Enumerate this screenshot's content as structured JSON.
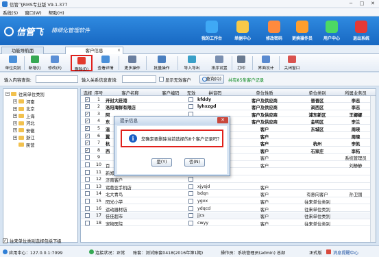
{
  "window": {
    "title": "信管飞RMS专业版 V9.1.377",
    "min": "─",
    "max": "□",
    "close": "✕"
  },
  "menu": [
    "系统(S)",
    "窗口(W)",
    "帮助(H)"
  ],
  "banner": {
    "logo": "信管飞",
    "subtitle": "精细化管理软件",
    "nav": [
      {
        "label": "我的工作台",
        "color": "#3fa9f5"
      },
      {
        "label": "单据中心",
        "color": "#f7c948"
      },
      {
        "label": "修改密码",
        "color": "#ff8a3d"
      },
      {
        "label": "更换操作员",
        "color": "#ff9e2c"
      },
      {
        "label": "用户中心",
        "color": "#4cd964"
      },
      {
        "label": "退出系统",
        "color": "#e53935"
      }
    ]
  },
  "tabs": [
    {
      "label": "功能导航面"
    },
    {
      "label": "客户信息",
      "close": "×"
    }
  ],
  "toolbar": [
    {
      "label": "单位类别",
      "icon": "category-icon",
      "color": "#4a90d9"
    },
    {
      "label": "新增(I)",
      "icon": "add-icon",
      "color": "#35a853"
    },
    {
      "label": "修改(E)",
      "icon": "edit-icon",
      "color": "#5b8fd6"
    },
    {
      "label": "删除(D)",
      "icon": "delete-icon",
      "color": "#e23a2e"
    },
    {
      "label": "查看详情",
      "icon": "view-icon",
      "color": "#4a90d9"
    },
    {
      "label": "更多操作",
      "icon": "more-icon",
      "color": "#6a7fa0"
    },
    {
      "label": "批量操作",
      "icon": "batch-icon",
      "color": "#4a7fc0"
    },
    {
      "label": "导入导出",
      "icon": "import-export-icon",
      "color": "#3aa0c8"
    },
    {
      "label": "排序设置",
      "icon": "sort-icon",
      "color": "#7a8fb0"
    },
    {
      "label": "打印",
      "icon": "print-icon",
      "color": "#6a7a90"
    },
    {
      "label": "界面设计",
      "icon": "layout-icon",
      "color": "#5a8ad0"
    },
    {
      "label": "关闭窗口",
      "icon": "close-window-icon",
      "color": "#d9534f"
    }
  ],
  "search": {
    "query_label": "输入内容查询:",
    "query_value": "",
    "condition_label": "输入关系信息查询:",
    "condition_value": "",
    "show_invalid": "显示无效客户",
    "query_button": "查询(Q)",
    "result": "共有85条客户记录"
  },
  "tree": {
    "root": "往来单位类别",
    "items": [
      "河南",
      "北京",
      "上海",
      "河北",
      "安徽",
      "浙江",
      "民营"
    ],
    "footer": "往来单位类别选择包括下级"
  },
  "table": {
    "columns": [
      "选择",
      "序号",
      "客户名称",
      "客户编码",
      "无效",
      "拼音码",
      "单位性质",
      "单位类别",
      "所属业务员"
    ],
    "rows": [
      {
        "sel": "✓",
        "no": "1",
        "name": "开封大莊港",
        "code": "",
        "inv": "",
        "py": "kfddy",
        "nature": "客户及供应商",
        "category": "晋晋区",
        "salesman": "李志",
        "bold": true
      },
      {
        "sel": "✓",
        "no": "2",
        "name": "洛阳海鲜有限店",
        "code": "",
        "inv": "",
        "py": "lyhxzgd",
        "nature": "客户及供应商",
        "category": "涧西区",
        "salesman": "李志",
        "bold": true
      },
      {
        "sel": "✓",
        "no": "3",
        "name": "阿",
        "code": "",
        "inv": "",
        "py": "",
        "nature": "客户及供应商",
        "category": "浦东新区",
        "salesman": "王娜娜",
        "bold": true
      },
      {
        "sel": "✓",
        "no": "4",
        "name": "东",
        "code": "",
        "inv": "",
        "py": "",
        "nature": "客户及供应商",
        "category": "金明区",
        "salesman": "李兰",
        "bold": true
      },
      {
        "sel": "✓",
        "no": "5",
        "name": "温",
        "code": "",
        "inv": "",
        "py": "",
        "nature": "客户",
        "category": "东城区",
        "salesman": "周晓",
        "bold": true
      },
      {
        "sel": "✓",
        "no": "6",
        "name": "翼",
        "code": "",
        "inv": "",
        "py": "",
        "nature": "客户",
        "category": "",
        "salesman": "周晓",
        "bold": true
      },
      {
        "sel": "✓",
        "no": "7",
        "name": "杭",
        "code": "",
        "inv": "",
        "py": "",
        "nature": "客户",
        "category": "杭州",
        "salesman": "李凯",
        "bold": true
      },
      {
        "sel": "✓",
        "no": "8",
        "name": "西",
        "code": "",
        "inv": "",
        "py": "",
        "nature": "客户",
        "category": "石家庄",
        "salesman": "李拓",
        "bold": true
      },
      {
        "sel": "",
        "no": "9",
        "name": "",
        "code": "",
        "inv": "",
        "py": "",
        "nature": "客户",
        "category": "",
        "salesman": "系统管理员",
        "bold": false
      },
      {
        "sel": "",
        "no": "10",
        "name": "百",
        "code": "",
        "inv": "",
        "py": "",
        "nature": "客户",
        "category": "",
        "salesman": "刘静静",
        "bold": false
      },
      {
        "sel": "",
        "no": "11",
        "name": "新郑市民",
        "code": "",
        "inv": "",
        "py": "",
        "nature": "",
        "category": "",
        "salesman": "",
        "bold": false
      },
      {
        "sel": "",
        "no": "12",
        "name": "济南客户",
        "code": "",
        "inv": "",
        "py": "",
        "nature": "",
        "category": "",
        "salesman": "",
        "bold": false
      },
      {
        "sel": "",
        "no": "13",
        "name": "诸葛亚手机店",
        "code": "",
        "inv": "",
        "py": "xjysjd",
        "nature": "客户",
        "category": "",
        "salesman": "",
        "bold": false
      },
      {
        "sel": "",
        "no": "14",
        "name": "北大青鸟",
        "code": "",
        "inv": "",
        "py": "bdqn",
        "nature": "客户",
        "category": "有意向客户",
        "salesman": "孙卫国",
        "bold": false
      },
      {
        "sel": "",
        "no": "15",
        "name": "阳光小学",
        "code": "",
        "inv": "",
        "py": "ygxx",
        "nature": "客户",
        "category": "往来单位类别",
        "salesman": "",
        "bold": false
      },
      {
        "sel": "",
        "no": "16",
        "name": "运动器材店",
        "code": "",
        "inv": "",
        "py": "ydqcd",
        "nature": "客户",
        "category": "往来单位类别",
        "salesman": "",
        "bold": false
      },
      {
        "sel": "",
        "no": "17",
        "name": "佳佳超市",
        "code": "",
        "inv": "",
        "py": "jjcs",
        "nature": "客户",
        "category": "往来单位类别",
        "salesman": "",
        "bold": false
      },
      {
        "sel": "",
        "no": "18",
        "name": "宠物医院",
        "code": "",
        "inv": "",
        "py": "cwyy",
        "nature": "客户",
        "category": "往来单位类别",
        "salesman": "",
        "bold": false
      }
    ]
  },
  "status": {
    "server": "应用中心：127.0.0.1:7099",
    "connection": "连接状况：正常",
    "account": "账套：测试账套0418(2016年第1期)",
    "operator": "操作员：系统管理员(admin) 总部",
    "edition": "正式版",
    "consult": "消息提醒中心"
  },
  "dialog": {
    "title": "提示信息",
    "close": "✕",
    "icon": "i",
    "message": "您确定要删除当前选择的8个客户记录吗？",
    "yes": "是(Y)",
    "no": "否(N)"
  }
}
